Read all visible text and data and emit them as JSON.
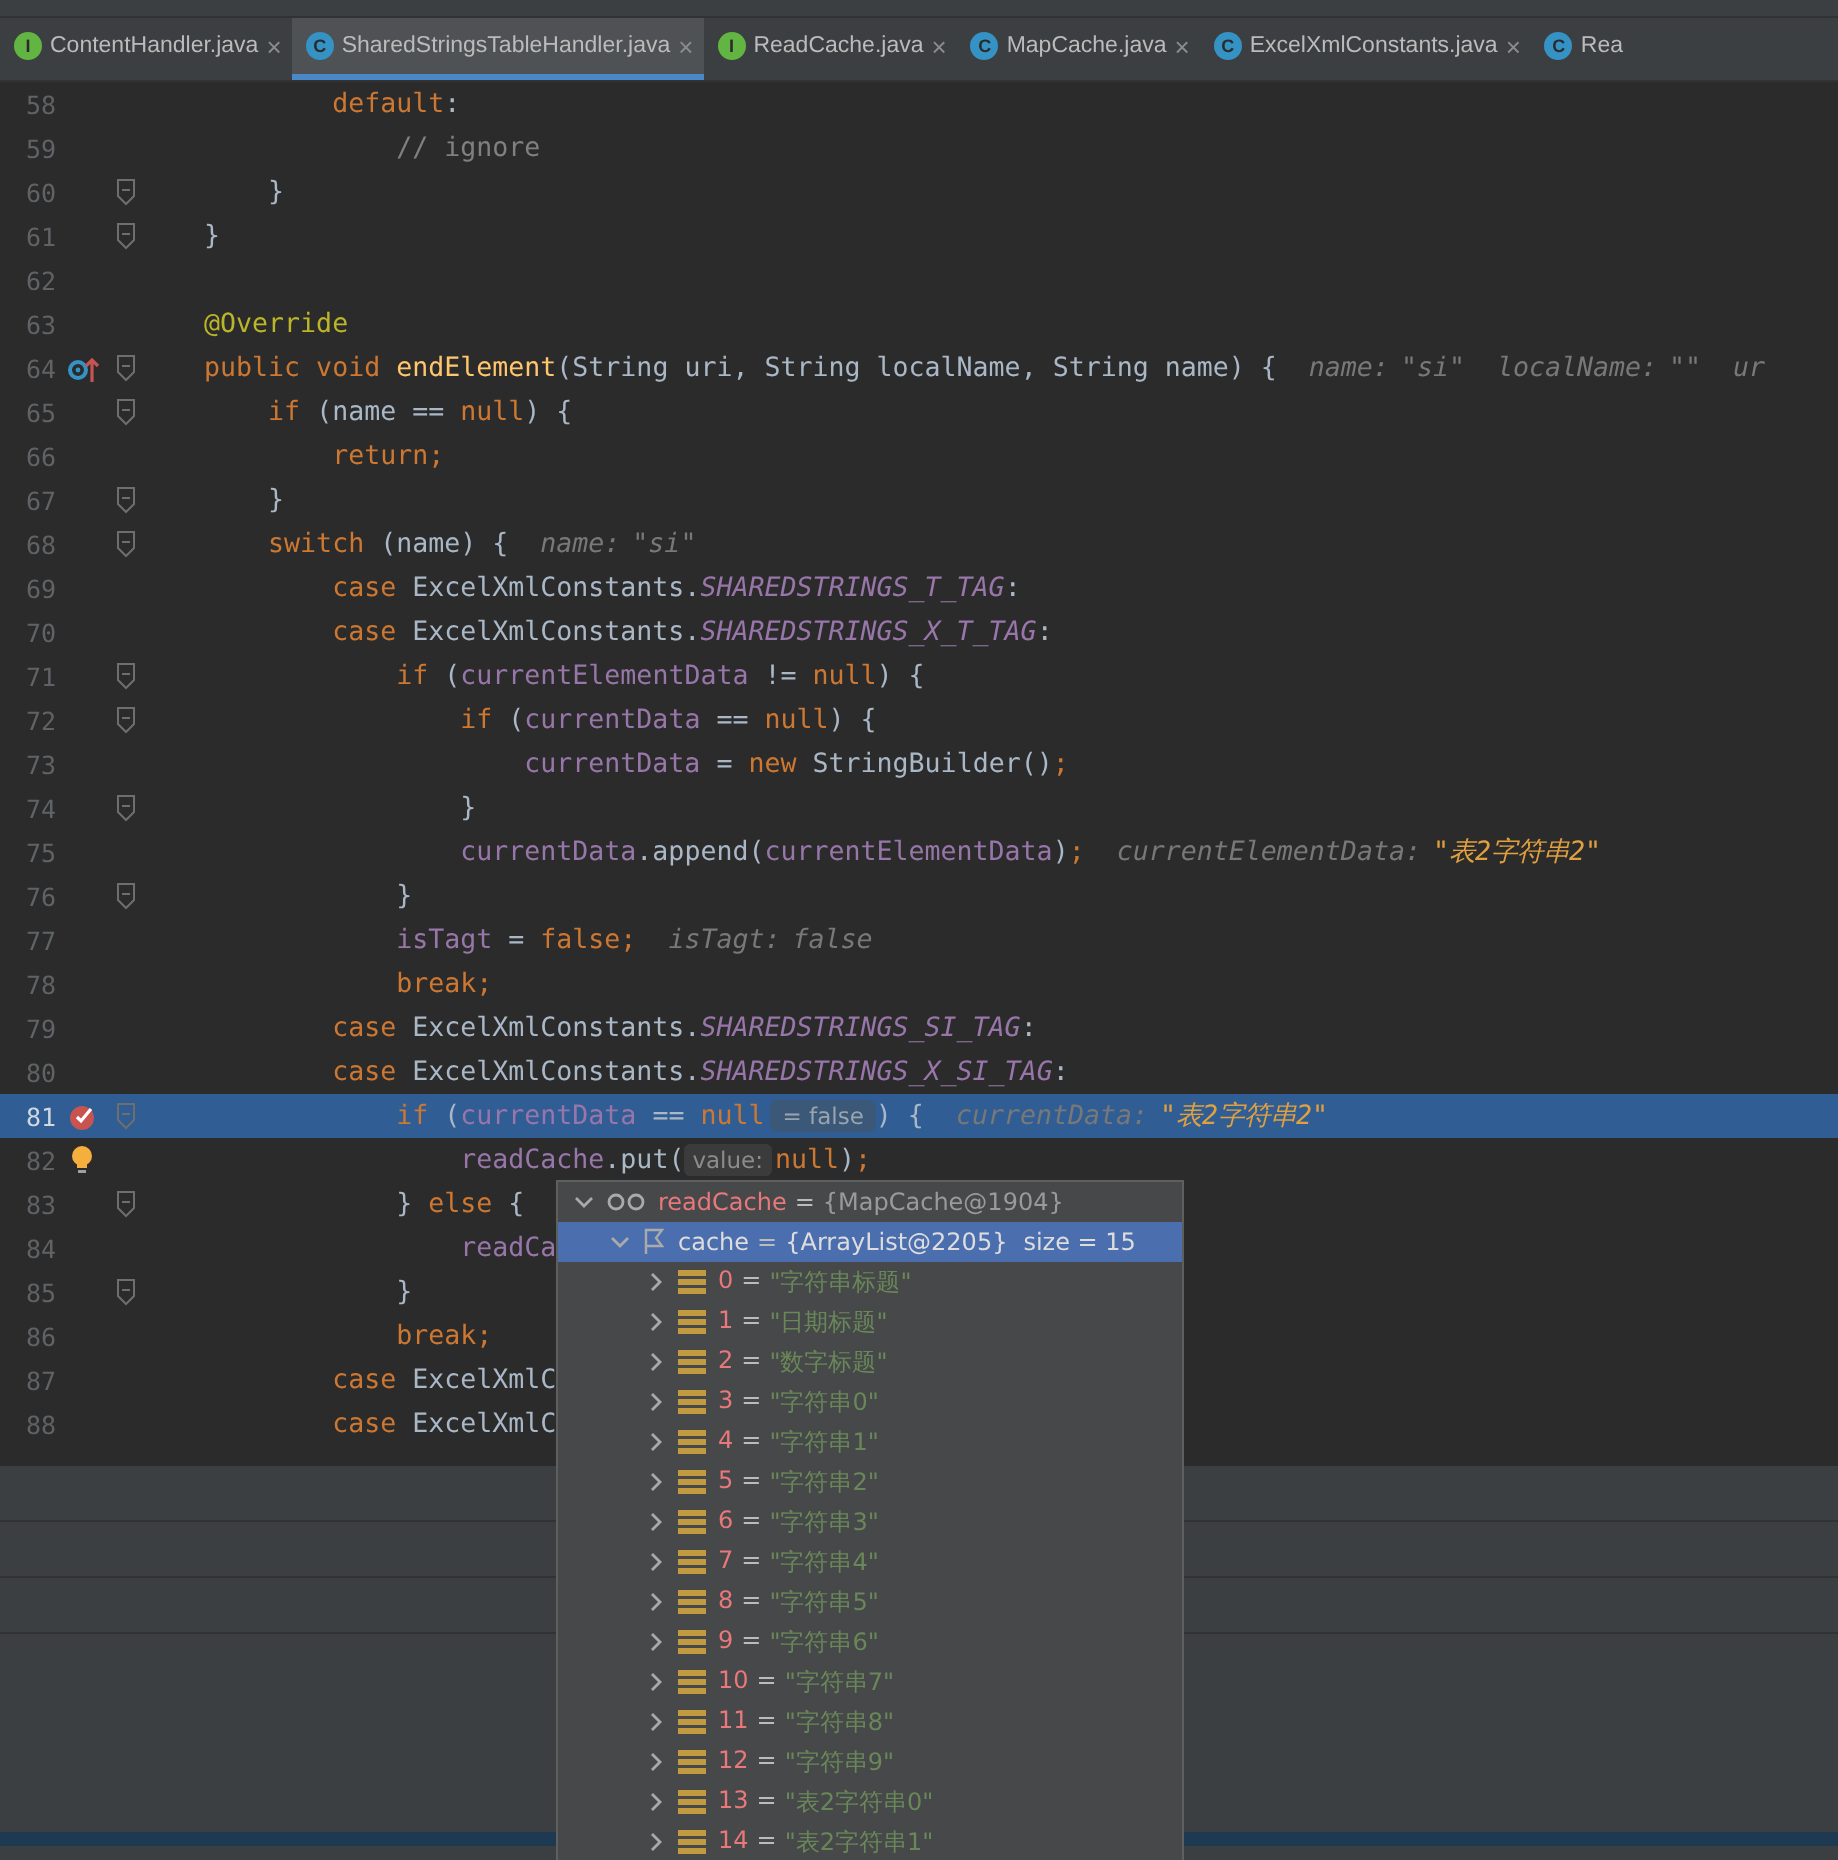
{
  "tabs": [
    {
      "badge": "I",
      "kind": "interface",
      "label": "ContentHandler.java",
      "close": "×",
      "selected": false
    },
    {
      "badge": "C",
      "kind": "class",
      "label": "SharedStringsTableHandler.java",
      "close": "×",
      "selected": true
    },
    {
      "badge": "I",
      "kind": "interface",
      "label": "ReadCache.java",
      "close": "×",
      "selected": false
    },
    {
      "badge": "C",
      "kind": "class",
      "label": "MapCache.java",
      "close": "×",
      "selected": false
    },
    {
      "badge": "C",
      "kind": "class",
      "label": "ExcelXmlConstants.java",
      "close": "×",
      "selected": false
    },
    {
      "badge": "C",
      "kind": "class",
      "label": "Rea",
      "selected": false
    }
  ],
  "editor": {
    "lines": [
      {
        "number": "58",
        "tokens": [
          {
            "kind": "kw",
            "text": "            default"
          },
          {
            "kind": "p",
            "text": ":"
          }
        ]
      },
      {
        "number": "59",
        "tokens": [
          {
            "kind": "cm",
            "text": "                // ignore"
          }
        ]
      },
      {
        "number": "60",
        "fold": true,
        "tokens": [
          {
            "kind": "p",
            "text": "        }"
          }
        ]
      },
      {
        "number": "61",
        "fold": true,
        "tokens": [
          {
            "kind": "p",
            "text": "    }"
          }
        ]
      },
      {
        "number": "62"
      },
      {
        "number": "63",
        "tokens": [
          {
            "kind": "an",
            "text": "    @Override"
          }
        ]
      },
      {
        "number": "64",
        "fold": true,
        "overridden": true,
        "tokens": [
          {
            "kind": "kw",
            "text": "    public void "
          },
          {
            "kind": "fn",
            "text": "endElement"
          },
          {
            "kind": "p",
            "text": "(String uri, String localName, String name) {"
          },
          {
            "kind": "hk",
            "text": "name:"
          },
          {
            "kind": "hv",
            "text": "\"si\""
          },
          {
            "kind": "hk",
            "text": "localName:"
          },
          {
            "kind": "hv",
            "text": "\"\""
          },
          {
            "kind": "hk",
            "text": "ur"
          }
        ]
      },
      {
        "number": "65",
        "fold": true,
        "tokens": [
          {
            "kind": "kw",
            "text": "        if "
          },
          {
            "kind": "p",
            "text": "(name == "
          },
          {
            "kind": "kw",
            "text": "null"
          },
          {
            "kind": "p",
            "text": ") {"
          }
        ]
      },
      {
        "number": "66",
        "tokens": [
          {
            "kind": "kw",
            "text": "            return;"
          }
        ]
      },
      {
        "number": "67",
        "fold": true,
        "tokens": [
          {
            "kind": "p",
            "text": "        }"
          }
        ]
      },
      {
        "number": "68",
        "fold": true,
        "tokens": [
          {
            "kind": "kw",
            "text": "        switch "
          },
          {
            "kind": "p",
            "text": "(name) {"
          },
          {
            "kind": "hk",
            "text": "name:"
          },
          {
            "kind": "hv",
            "text": "\"si\""
          }
        ]
      },
      {
        "number": "69",
        "tokens": [
          {
            "kind": "kw",
            "text": "            case "
          },
          {
            "kind": "p",
            "text": "ExcelXmlConstants."
          },
          {
            "kind": "ct",
            "text": "SHAREDSTRINGS_T_TAG"
          },
          {
            "kind": "p",
            "text": ":"
          }
        ]
      },
      {
        "number": "70",
        "tokens": [
          {
            "kind": "kw",
            "text": "            case "
          },
          {
            "kind": "p",
            "text": "ExcelXmlConstants."
          },
          {
            "kind": "ct",
            "text": "SHAREDSTRINGS_X_T_TAG"
          },
          {
            "kind": "p",
            "text": ":"
          }
        ]
      },
      {
        "number": "71",
        "fold": true,
        "tokens": [
          {
            "kind": "kw",
            "text": "                if "
          },
          {
            "kind": "p",
            "text": "("
          },
          {
            "kind": "fd",
            "text": "currentElementData"
          },
          {
            "kind": "p",
            "text": " != "
          },
          {
            "kind": "kw",
            "text": "null"
          },
          {
            "kind": "p",
            "text": ") {"
          }
        ]
      },
      {
        "number": "72",
        "fold": true,
        "tokens": [
          {
            "kind": "kw",
            "text": "                    if "
          },
          {
            "kind": "p",
            "text": "("
          },
          {
            "kind": "fd",
            "text": "currentData"
          },
          {
            "kind": "p",
            "text": " == "
          },
          {
            "kind": "kw",
            "text": "null"
          },
          {
            "kind": "p",
            "text": ") {"
          }
        ]
      },
      {
        "number": "73",
        "tokens": [
          {
            "kind": "fd",
            "text": "                        currentData"
          },
          {
            "kind": "p",
            "text": " = "
          },
          {
            "kind": "kw",
            "text": "new "
          },
          {
            "kind": "p",
            "text": "StringBuilder()"
          },
          {
            "kind": "kw",
            "text": ";"
          }
        ]
      },
      {
        "number": "74",
        "fold": true,
        "tokens": [
          {
            "kind": "p",
            "text": "                    }"
          }
        ]
      },
      {
        "number": "75",
        "tokens": [
          {
            "kind": "fd",
            "text": "                    currentData"
          },
          {
            "kind": "p",
            "text": ".append("
          },
          {
            "kind": "fd",
            "text": "currentElementData"
          },
          {
            "kind": "p",
            "text": ")"
          },
          {
            "kind": "kw",
            "text": ";"
          },
          {
            "kind": "hk",
            "text": "currentElementData:"
          },
          {
            "kind": "hs",
            "text": "\"表2字符串2\""
          }
        ]
      },
      {
        "number": "76",
        "fold": true,
        "tokens": [
          {
            "kind": "p",
            "text": "                }"
          }
        ]
      },
      {
        "number": "77",
        "tokens": [
          {
            "kind": "fd",
            "text": "                isTagt"
          },
          {
            "kind": "p",
            "text": " = "
          },
          {
            "kind": "kw",
            "text": "false;"
          },
          {
            "kind": "hk",
            "text": "isTagt:"
          },
          {
            "kind": "hv",
            "text": "false"
          }
        ]
      },
      {
        "number": "78",
        "tokens": [
          {
            "kind": "kw",
            "text": "                break;"
          }
        ]
      },
      {
        "number": "79",
        "tokens": [
          {
            "kind": "kw",
            "text": "            case "
          },
          {
            "kind": "p",
            "text": "ExcelXmlConstants."
          },
          {
            "kind": "ct",
            "text": "SHAREDSTRINGS_SI_TAG"
          },
          {
            "kind": "p",
            "text": ":"
          }
        ]
      },
      {
        "number": "80",
        "tokens": [
          {
            "kind": "kw",
            "text": "            case "
          },
          {
            "kind": "p",
            "text": "ExcelXmlConstants."
          },
          {
            "kind": "ct",
            "text": "SHAREDSTRINGS_X_SI_TAG"
          },
          {
            "kind": "p",
            "text": ":"
          }
        ]
      },
      {
        "number": "81",
        "fold": true,
        "current": true,
        "breakpoint": true,
        "tokens": [
          {
            "kind": "kw",
            "text": "                if "
          },
          {
            "kind": "p",
            "text": "("
          },
          {
            "kind": "fd",
            "text": "currentData"
          },
          {
            "kind": "p",
            "text": " == "
          },
          {
            "kind": "kw",
            "text": "null"
          },
          {
            "kind": "chip",
            "text": "= false"
          },
          {
            "kind": "p",
            "text": ") {"
          },
          {
            "kind": "hk",
            "text": "currentData:"
          },
          {
            "kind": "hs",
            "text": "\"表2字符串2\""
          }
        ]
      },
      {
        "number": "82",
        "bulb": true,
        "tokens": [
          {
            "kind": "fd",
            "text": "                    readCache"
          },
          {
            "kind": "p",
            "text": ".put("
          },
          {
            "kind": "param",
            "text": "value:"
          },
          {
            "kind": "kw",
            "text": "null"
          },
          {
            "kind": "p",
            "text": ")"
          },
          {
            "kind": "kw",
            "text": ";"
          }
        ]
      },
      {
        "number": "83",
        "fold": true,
        "tokens": [
          {
            "kind": "p",
            "text": "                } "
          },
          {
            "kind": "kw",
            "text": "else "
          },
          {
            "kind": "p",
            "text": "{"
          }
        ]
      },
      {
        "number": "84",
        "tokens": [
          {
            "kind": "fd",
            "text": "                    readCa"
          }
        ]
      },
      {
        "number": "85",
        "fold": true,
        "tokens": [
          {
            "kind": "p",
            "text": "                }"
          }
        ]
      },
      {
        "number": "86",
        "tokens": [
          {
            "kind": "kw",
            "text": "                break;"
          }
        ]
      },
      {
        "number": "87",
        "tokens": [
          {
            "kind": "kw",
            "text": "            case "
          },
          {
            "kind": "p",
            "text": "ExcelXmlC"
          }
        ]
      },
      {
        "number": "88",
        "tokens": [
          {
            "kind": "kw",
            "text": "            case "
          },
          {
            "kind": "p",
            "text": "ExcelXmlC"
          }
        ]
      }
    ]
  },
  "popup": {
    "nodes": [
      {
        "kind": "watch",
        "name": "readCache",
        "op": "=",
        "value": "{MapCache@1904}",
        "expanded": true,
        "selected": false,
        "children": [
          {
            "kind": "field",
            "name": "cache",
            "op": "=",
            "value": "{ArrayList@2205}",
            "extra": "size = 15",
            "expanded": true,
            "selected": true,
            "children": [
              {
                "kind": "element",
                "name": "0",
                "op": "=",
                "value": "\"字符串标题\"",
                "expanded": false,
                "selected": false
              },
              {
                "kind": "element",
                "name": "1",
                "op": "=",
                "value": "\"日期标题\"",
                "expanded": false,
                "selected": false
              },
              {
                "kind": "element",
                "name": "2",
                "op": "=",
                "value": "\"数字标题\"",
                "expanded": false,
                "selected": false
              },
              {
                "kind": "element",
                "name": "3",
                "op": "=",
                "value": "\"字符串0\"",
                "expanded": false,
                "selected": false
              },
              {
                "kind": "element",
                "name": "4",
                "op": "=",
                "value": "\"字符串1\"",
                "expanded": false,
                "selected": false
              },
              {
                "kind": "element",
                "name": "5",
                "op": "=",
                "value": "\"字符串2\"",
                "expanded": false,
                "selected": false
              },
              {
                "kind": "element",
                "name": "6",
                "op": "=",
                "value": "\"字符串3\"",
                "expanded": false,
                "selected": false
              },
              {
                "kind": "element",
                "name": "7",
                "op": "=",
                "value": "\"字符串4\"",
                "expanded": false,
                "selected": false
              },
              {
                "kind": "element",
                "name": "8",
                "op": "=",
                "value": "\"字符串5\"",
                "expanded": false,
                "selected": false
              },
              {
                "kind": "element",
                "name": "9",
                "op": "=",
                "value": "\"字符串6\"",
                "expanded": false,
                "selected": false
              },
              {
                "kind": "element",
                "name": "10",
                "op": "=",
                "value": "\"字符串7\"",
                "expanded": false,
                "selected": false
              },
              {
                "kind": "element",
                "name": "11",
                "op": "=",
                "value": "\"字符串8\"",
                "expanded": false,
                "selected": false
              },
              {
                "kind": "element",
                "name": "12",
                "op": "=",
                "value": "\"字符串9\"",
                "expanded": false,
                "selected": false
              },
              {
                "kind": "element",
                "name": "13",
                "op": "=",
                "value": "\"表2字符串0\"",
                "expanded": false,
                "selected": false
              },
              {
                "kind": "element",
                "name": "14",
                "op": "=",
                "value": "\"表2字符串1\"",
                "expanded": false,
                "selected": false
              }
            ]
          }
        ]
      }
    ]
  }
}
